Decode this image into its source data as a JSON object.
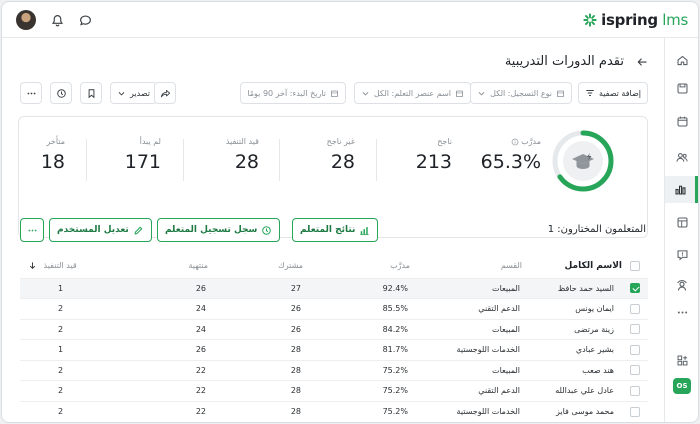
{
  "app": {
    "logo_main": "ispring",
    "logo_suffix": " lms",
    "brand_color": "#27a65a"
  },
  "topbar": {
    "icons": [
      "bell-icon",
      "chat-icon"
    ]
  },
  "sidebar": {
    "items": [
      "home-icon",
      "save-icon",
      "calendar-icon",
      "users-icon",
      "reports-icon",
      "courses-icon",
      "help-icon",
      "team-icon",
      "more-icon",
      "add-app-icon"
    ],
    "active": "reports-icon",
    "badge": "OS"
  },
  "page": {
    "title": "تقدم الدورات التدريبية"
  },
  "filters": {
    "add_filter": "إضافة تصفية",
    "registration_type": "نوع التسجيل: الكل",
    "learner_element": "اسم عنصر التعلم: الكل",
    "start_date": "تاريخ البدء: آخر 90 يومًا",
    "export": "تصدير"
  },
  "stats": {
    "trained_label": "مدرَّب",
    "trained_value": "65.3%",
    "trained_fraction": 0.653,
    "passed_label": "ناجح",
    "passed_value": "213",
    "failed_label": "غير ناجح",
    "failed_value": "28",
    "in_progress_label": "قيد التنفيذ",
    "in_progress_value": "28",
    "not_started_label": "لم يبدأ",
    "not_started_value": "171",
    "late_label": "متأخر",
    "late_value": "18"
  },
  "selection": {
    "label": "المتعلمون المختارون: 1"
  },
  "actions": {
    "learner_results": "نتائج المتعلم",
    "enrollment_log": "سجل تسجيل المتعلم",
    "edit_user": "تعديل المستخدم"
  },
  "table": {
    "headers": {
      "name": "الاسم الكامل",
      "department": "القسم",
      "trained": "مدرَّب",
      "enrolled": "مشترك",
      "completed": "منتهية",
      "in_progress": "قيد التنفيذ"
    },
    "rows": [
      {
        "name": "السيد حمد حافظ",
        "department": "المبيعات",
        "trained": "92.4%",
        "enrolled": "27",
        "completed": "26",
        "in_progress": "1",
        "selected": true
      },
      {
        "name": "ايمان يونس",
        "department": "الدعم التقني",
        "trained": "85.5%",
        "enrolled": "26",
        "completed": "24",
        "in_progress": "2",
        "selected": false
      },
      {
        "name": "زينة مرتضى",
        "department": "المبيعات",
        "trained": "84.2%",
        "enrolled": "26",
        "completed": "24",
        "in_progress": "2",
        "selected": false
      },
      {
        "name": "بشير عبادي",
        "department": "الخدمات اللوجستية",
        "trained": "81.7%",
        "enrolled": "28",
        "completed": "26",
        "in_progress": "1",
        "selected": false
      },
      {
        "name": "هند صعب",
        "department": "المبيعات",
        "trained": "75.2%",
        "enrolled": "28",
        "completed": "22",
        "in_progress": "2",
        "selected": false
      },
      {
        "name": "عادل علي عبدالله",
        "department": "الدعم التقني",
        "trained": "75.2%",
        "enrolled": "28",
        "completed": "22",
        "in_progress": "2",
        "selected": false
      },
      {
        "name": "محمد موسى فايز",
        "department": "الخدمات اللوجستية",
        "trained": "75.2%",
        "enrolled": "28",
        "completed": "22",
        "in_progress": "2",
        "selected": false
      }
    ]
  }
}
